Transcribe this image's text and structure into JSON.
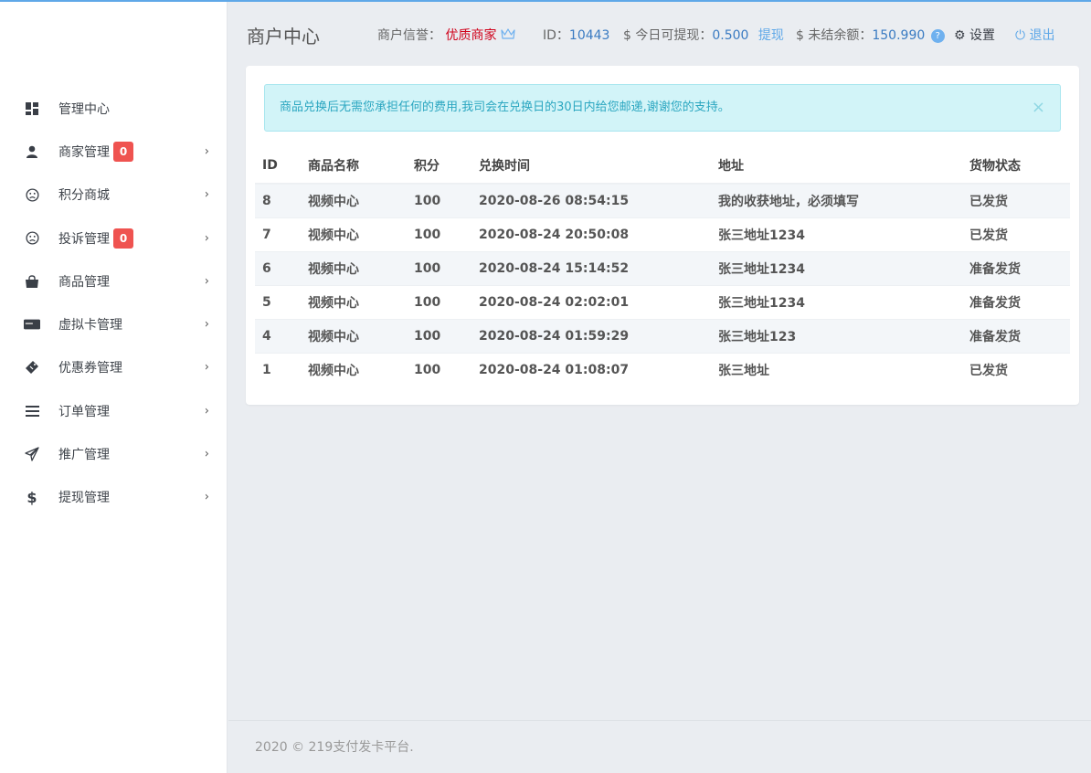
{
  "header": {
    "title": "商户中心",
    "credit_label": "商户信誉：",
    "credit_value": "优质商家",
    "id_label": "ID：",
    "id_value": "10443",
    "withdrawable_label": "今日可提现：",
    "withdrawable_value": "0.500",
    "withdraw_link": "提现",
    "unsettled_label": "未结余额：",
    "unsettled_value": "150.990",
    "settings_label": "设置",
    "logout_label": "退出"
  },
  "sidebar": {
    "items": [
      {
        "label": "管理中心",
        "icon": "dashboard-icon"
      },
      {
        "label": "商家管理",
        "icon": "user-icon",
        "badge": "0"
      },
      {
        "label": "积分商城",
        "icon": "frown-icon"
      },
      {
        "label": "投诉管理",
        "icon": "frown-icon",
        "badge": "0"
      },
      {
        "label": "商品管理",
        "icon": "shopping-bag-icon"
      },
      {
        "label": "虚拟卡管理",
        "icon": "credit-card-icon"
      },
      {
        "label": "优惠券管理",
        "icon": "ticket-icon"
      },
      {
        "label": "订单管理",
        "icon": "list-icon"
      },
      {
        "label": "推广管理",
        "icon": "paper-plane-icon"
      },
      {
        "label": "提现管理",
        "icon": "dollar-icon"
      }
    ]
  },
  "alert": {
    "text": "商品兑换后无需您承担任何的费用,我司会在兑换日的30日内给您邮递,谢谢您的支持。",
    "close": "×"
  },
  "table": {
    "headers": [
      "ID",
      "商品名称",
      "积分",
      "兑换时间",
      "地址",
      "货物状态"
    ],
    "rows": [
      [
        "8",
        "视频中心",
        "100",
        "2020-08-26 08:54:15",
        "我的收获地址，必须填写",
        "已发货"
      ],
      [
        "7",
        "视频中心",
        "100",
        "2020-08-24 20:50:08",
        "张三地址1234",
        "已发货"
      ],
      [
        "6",
        "视频中心",
        "100",
        "2020-08-24 15:14:52",
        "张三地址1234",
        "准备发货"
      ],
      [
        "5",
        "视频中心",
        "100",
        "2020-08-24 02:02:01",
        "张三地址1234",
        "准备发货"
      ],
      [
        "4",
        "视频中心",
        "100",
        "2020-08-24 01:59:29",
        "张三地址123",
        "准备发货"
      ],
      [
        "1",
        "视频中心",
        "100",
        "2020-08-24 01:08:07",
        "张三地址",
        "已发货"
      ]
    ]
  },
  "footer": {
    "text": "2020 © 219支付发卡平台."
  },
  "colors": {
    "accent": "#5fa8e8",
    "badge": "#ef5350",
    "credit": "#d0021b",
    "alert_bg": "#d2f4f8",
    "alert_text": "#2aa6c0"
  }
}
